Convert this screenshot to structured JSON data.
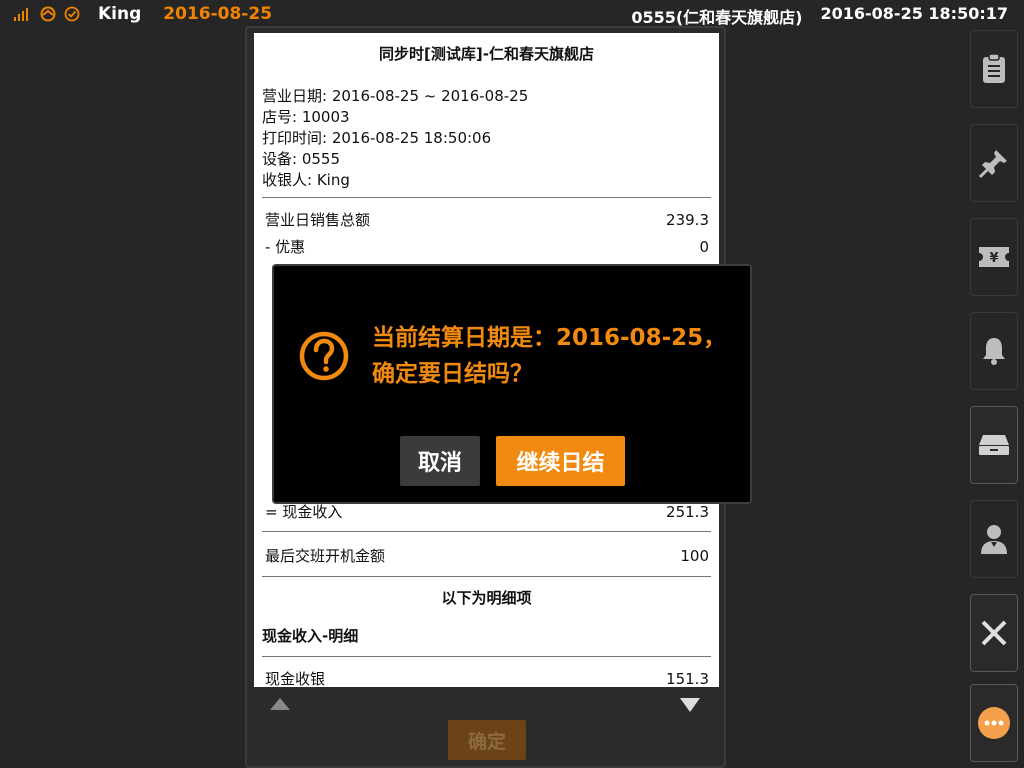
{
  "status_bar": {
    "icons": [
      "signal-icon",
      "cloud-sync-icon",
      "check-circle-icon"
    ],
    "user": "King",
    "business_date": "2016-08-25",
    "device_store": "0555(仁和春天旗舰店)",
    "datetime": "2016-08-25 18:50:17",
    "accent_color": "#f08300"
  },
  "receipt": {
    "title": "同步时[测试库]-仁和春天旗舰店",
    "info": [
      "营业日期: 2016-08-25 ~ 2016-08-25",
      "店号: 10003",
      "打印时间: 2016-08-25 18:50:06",
      "设备: 0555",
      "收银人: King"
    ],
    "rows_top": [
      {
        "label": "营业日销售总额",
        "value": "239.3"
      },
      {
        "label": "- 优惠",
        "value": "0"
      }
    ],
    "row_cash": {
      "label": "= 现金收入",
      "value": "251.3"
    },
    "row_shift": {
      "label": "最后交班开机金额",
      "value": "100"
    },
    "section_title": "以下为明细项",
    "sub_title": "现金收入-明细",
    "row_detail": {
      "label": "现金收银",
      "value": "151.3"
    },
    "confirm_label": "确定"
  },
  "sidebar": {
    "buttons": [
      {
        "name": "clipboard-icon"
      },
      {
        "name": "pin-icon"
      },
      {
        "name": "yen-ticket-icon"
      },
      {
        "name": "bell-icon"
      },
      {
        "name": "cash-drawer-icon"
      },
      {
        "name": "cashier-person-icon"
      },
      {
        "name": "close-icon"
      },
      {
        "name": "more-icon"
      }
    ]
  },
  "dialog": {
    "line1": "当前结算日期是：2016-08-25，",
    "line2": "确定要日结吗？",
    "cancel_label": "取消",
    "continue_label": "继续日结",
    "accent_color": "#f28a10"
  }
}
